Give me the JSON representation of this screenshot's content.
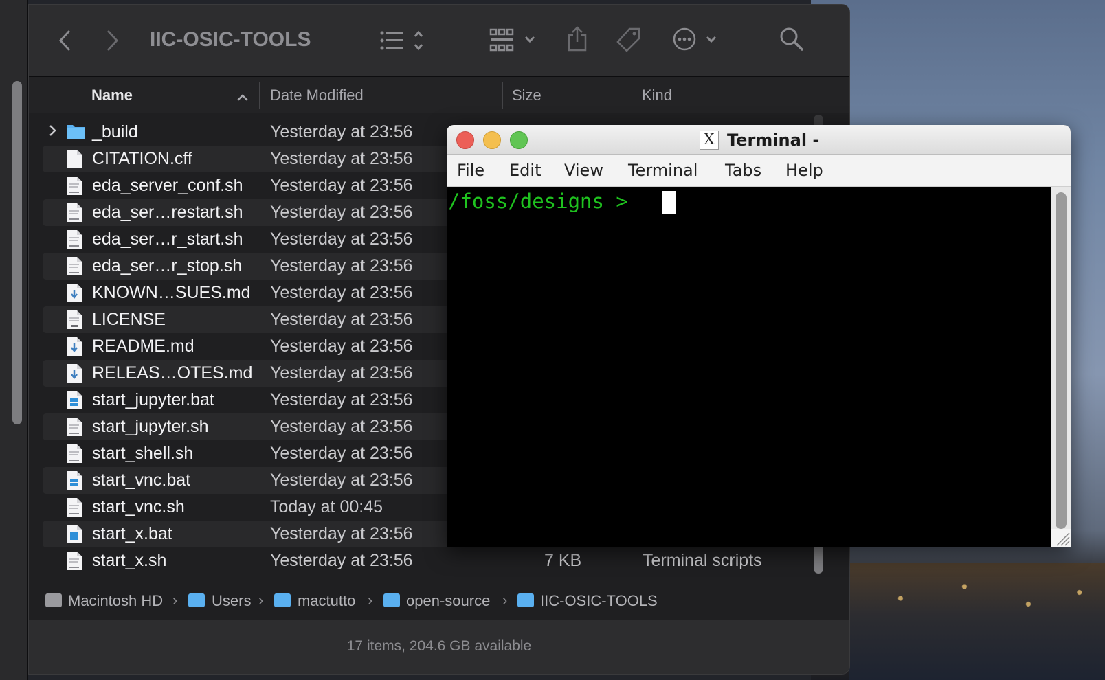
{
  "finder": {
    "title": "IIC-OSIC-TOOLS",
    "columns": {
      "name": "Name",
      "date": "Date Modified",
      "size": "Size",
      "kind": "Kind"
    },
    "files": [
      {
        "name": "_build",
        "date": "Yesterday at 23:56",
        "size": "",
        "kind": "",
        "icon": "folder-icon"
      },
      {
        "name": "CITATION.cff",
        "date": "Yesterday at 23:56",
        "size": "",
        "kind": "",
        "icon": "document-icon"
      },
      {
        "name": "eda_server_conf.sh",
        "date": "Yesterday at 23:56",
        "size": "",
        "kind": "",
        "icon": "shell-script-icon"
      },
      {
        "name": "eda_ser…restart.sh",
        "date": "Yesterday at 23:56",
        "size": "",
        "kind": "",
        "icon": "shell-script-icon"
      },
      {
        "name": "eda_ser…r_start.sh",
        "date": "Yesterday at 23:56",
        "size": "",
        "kind": "",
        "icon": "shell-script-icon"
      },
      {
        "name": "eda_ser…r_stop.sh",
        "date": "Yesterday at 23:56",
        "size": "",
        "kind": "",
        "icon": "shell-script-icon"
      },
      {
        "name": "KNOWN…SUES.md",
        "date": "Yesterday at 23:56",
        "size": "",
        "kind": "",
        "icon": "markdown-icon"
      },
      {
        "name": "LICENSE",
        "date": "Yesterday at 23:56",
        "size": "",
        "kind": "",
        "icon": "text-file-icon"
      },
      {
        "name": "README.md",
        "date": "Yesterday at 23:56",
        "size": "",
        "kind": "",
        "icon": "markdown-icon"
      },
      {
        "name": "RELEAS…OTES.md",
        "date": "Yesterday at 23:56",
        "size": "",
        "kind": "",
        "icon": "markdown-icon"
      },
      {
        "name": "start_jupyter.bat",
        "date": "Yesterday at 23:56",
        "size": "",
        "kind": "",
        "icon": "windows-batch-icon"
      },
      {
        "name": "start_jupyter.sh",
        "date": "Yesterday at 23:56",
        "size": "",
        "kind": "",
        "icon": "shell-script-icon"
      },
      {
        "name": "start_shell.sh",
        "date": "Yesterday at 23:56",
        "size": "",
        "kind": "",
        "icon": "shell-script-icon"
      },
      {
        "name": "start_vnc.bat",
        "date": "Yesterday at 23:56",
        "size": "",
        "kind": "",
        "icon": "windows-batch-icon"
      },
      {
        "name": "start_vnc.sh",
        "date": "Today at 00:45",
        "size": "",
        "kind": "",
        "icon": "shell-script-icon"
      },
      {
        "name": "start_x.bat",
        "date": "Yesterday at 23:56",
        "size": "",
        "kind": "",
        "icon": "windows-batch-icon"
      },
      {
        "name": "start_x.sh",
        "date": "Yesterday at 23:56",
        "size": "7 KB",
        "kind": "Terminal scripts",
        "icon": "shell-script-icon"
      }
    ],
    "path": [
      "Macintosh HD",
      "Users",
      "mactutto",
      "open-source",
      "IIC-OSIC-TOOLS"
    ],
    "status": "17 items, 204.6 GB available"
  },
  "terminal": {
    "title": "Terminal -",
    "menu": [
      "File",
      "Edit",
      "View",
      "Terminal",
      "Tabs",
      "Help"
    ],
    "prompt": "/foss/designs > "
  },
  "colors": {
    "prompt_green": "#1fc21f",
    "close_red": "#ec5f57",
    "minimize_yellow": "#f4bf4f",
    "zoom_green": "#61c554",
    "folder_blue": "#5ab0f0"
  }
}
